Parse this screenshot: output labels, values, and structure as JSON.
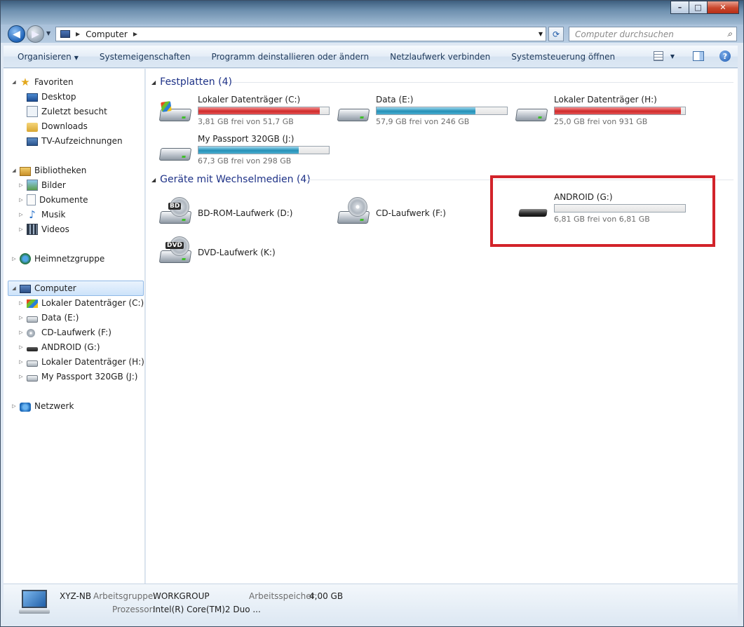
{
  "window": {
    "caption_minimize": "–",
    "caption_maximize": "□",
    "caption_close": "✕"
  },
  "address": {
    "root_icon": "computer-icon",
    "path": "Computer",
    "search_placeholder": "Computer durchsuchen"
  },
  "toolbar": {
    "organize": "Organisieren",
    "system_properties": "Systemeigenschaften",
    "uninstall": "Programm deinstallieren oder ändern",
    "map_drive": "Netzlaufwerk verbinden",
    "control_panel": "Systemsteuerung öffnen"
  },
  "nav": {
    "favorites": "Favoriten",
    "desktop": "Desktop",
    "recent": "Zuletzt besucht",
    "downloads": "Downloads",
    "tv": "TV-Aufzeichnungen",
    "libraries": "Bibliotheken",
    "pictures": "Bilder",
    "documents": "Dokumente",
    "music": "Musik",
    "videos": "Videos",
    "homegroup": "Heimnetzgruppe",
    "computer": "Computer",
    "drive_c": "Lokaler Datenträger (C:)",
    "drive_e": "Data (E:)",
    "drive_f": "CD-Laufwerk (F:)",
    "drive_g": "ANDROID (G:)",
    "drive_h": "Lokaler Datenträger (H:)",
    "drive_j": "My Passport 320GB (J:)",
    "network": "Netzwerk"
  },
  "content": {
    "hard_disks_header": "Festplatten (4)",
    "removable_header": "Geräte mit Wechselmedien (4)",
    "hard_disks": [
      {
        "name": "Lokaler Datenträger (C:)",
        "free": "3,81 GB frei von 51,7 GB",
        "used_fraction": 0.93,
        "color": "#d12b2b"
      },
      {
        "name": "Data (E:)",
        "free": "57,9 GB frei von 246 GB",
        "used_fraction": 0.76,
        "color": "#2590b7"
      },
      {
        "name": "Lokaler Datenträger (H:)",
        "free": "25,0 GB frei von 931 GB",
        "used_fraction": 0.97,
        "color": "#d12b2b"
      },
      {
        "name": "My Passport 320GB (J:)",
        "free": "67,3 GB frei von 298 GB",
        "used_fraction": 0.77,
        "color": "#2590b7"
      }
    ],
    "removable": [
      {
        "name": "BD-ROM-Laufwerk (D:)",
        "disc_label": "BD"
      },
      {
        "name": "CD-Laufwerk (F:)"
      },
      {
        "name": "ANDROID (G:)",
        "free": "6,81 GB frei von 6,81 GB",
        "used_fraction": 0.0
      },
      {
        "name": "DVD-Laufwerk (K:)",
        "disc_label": "DVD"
      }
    ]
  },
  "details": {
    "computer_name": "XYZ-NB",
    "workgroup_label": "Arbeitsgruppe:",
    "workgroup_value": "WORKGROUP",
    "memory_label": "Arbeitsspeicher:",
    "memory_value": "4,00 GB",
    "cpu_label": "Prozessor:",
    "cpu_value": "Intel(R) Core(TM)2 Duo ..."
  },
  "colors": {
    "highlight_box": "#d2232a",
    "group_header": "#1e3287"
  }
}
